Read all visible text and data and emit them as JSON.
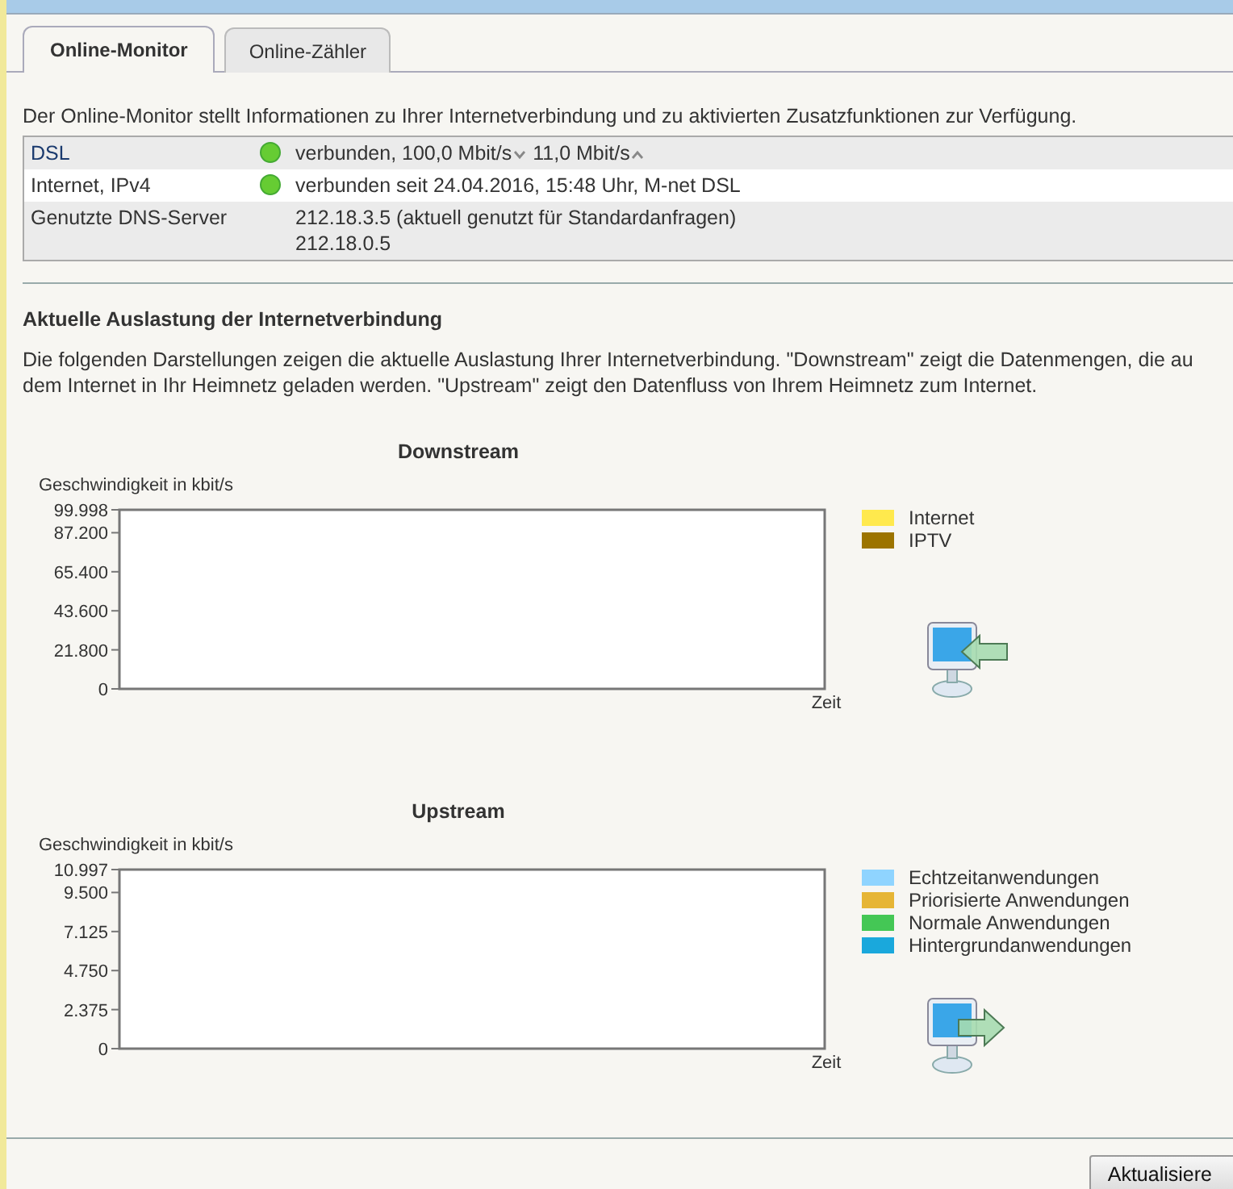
{
  "tabs": [
    {
      "label": "Online-Monitor",
      "selected": true
    },
    {
      "label": "Online-Zähler",
      "selected": false
    }
  ],
  "intro": "Der Online-Monitor stellt Informationen zu Ihrer Internetverbindung und zu aktivierten Zusatzfunktionen zur Verfügung.",
  "status_table": [
    {
      "label": "DSL",
      "link": true,
      "color": "#66cc33",
      "segments": [
        {
          "text": "verbunden, 100,0 Mbit/s",
          "kind": "down"
        },
        {
          "text": "11,0 Mbit/s",
          "kind": "up"
        }
      ]
    },
    {
      "label": "Internet, IPv4",
      "link": false,
      "color": "#66cc33",
      "segments": [
        {
          "text": "verbunden seit 24.04.2016, 15:48 Uhr, M-net DSL",
          "kind": "plain"
        }
      ]
    },
    {
      "label": "Genutzte DNS-Server",
      "link": false,
      "segments": [
        {
          "text": "212.18.3.5 (aktuell genutzt für Standardanfragen)",
          "kind": "line"
        },
        {
          "text": "212.18.0.5",
          "kind": "line"
        }
      ]
    }
  ],
  "load_section": {
    "heading": "Aktuelle Auslastung der Internetverbindung",
    "description": [
      "Die folgenden Darstellungen zeigen die aktuelle Auslastung Ihrer Internetverbindung. \"Downstream\" zeigt die Datenmengen, die au",
      "dem Internet in Ihr Heimnetz geladen werden. \"Upstream\" zeigt den Datenfluss von Ihrem Heimnetz zum Internet."
    ],
    "charts": [
      {
        "kind": "downstream",
        "title": "Downstream",
        "y_axis_label": "Geschwindigkeit in kbit/s",
        "x_axis_label": "Zeit",
        "y_tick_labels": [
          "99.998",
          "87.200",
          "65.400",
          "43.600",
          "21.800",
          "0"
        ],
        "legend": [
          {
            "name": "Internet",
            "color": "#ffe94d"
          },
          {
            "name": "IPTV",
            "color": "#9c7400"
          }
        ]
      },
      {
        "kind": "upstream",
        "title": "Upstream",
        "y_axis_label": "Geschwindigkeit in kbit/s",
        "x_axis_label": "Zeit",
        "y_tick_labels": [
          "10.997",
          "9.500",
          "7.125",
          "4.750",
          "2.375",
          "0"
        ],
        "legend": [
          {
            "name": "Echtzeitanwendungen",
            "color": "#8fd4ff"
          },
          {
            "name": "Priorisierte Anwendungen",
            "color": "#e6b535"
          },
          {
            "name": "Normale Anwendungen",
            "color": "#44c755"
          },
          {
            "name": "Hintergrundanwendungen",
            "color": "#1aa8dc"
          }
        ]
      }
    ]
  },
  "buttons": [
    {
      "label": "Aktualisiere"
    }
  ]
}
